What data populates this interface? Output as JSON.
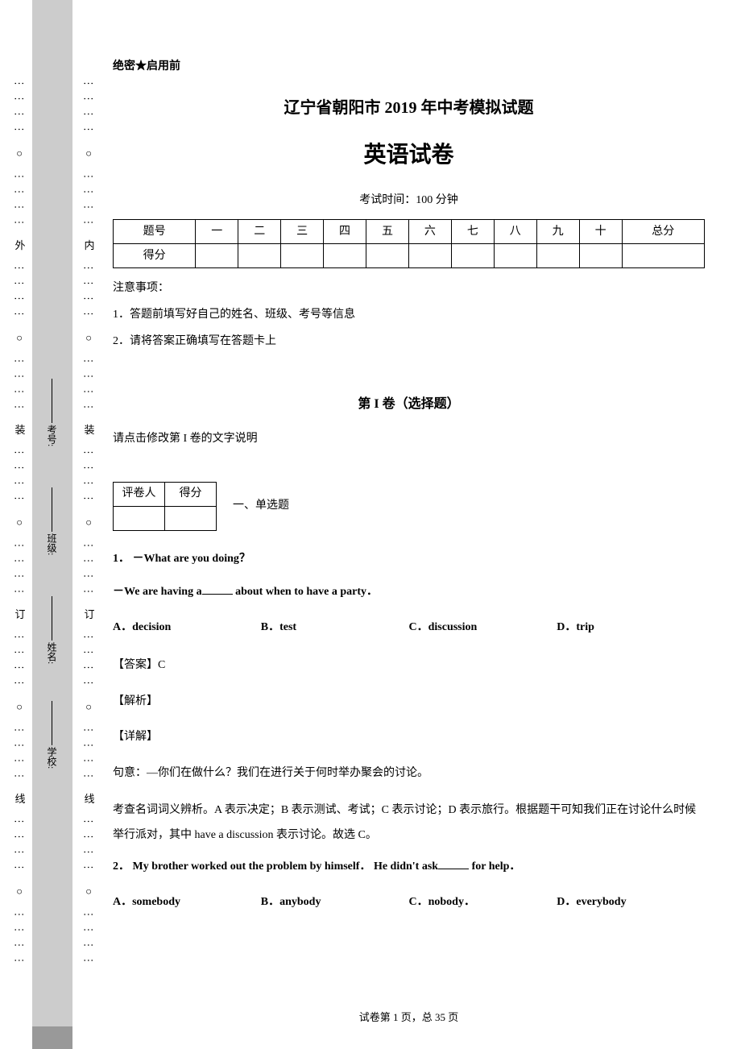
{
  "margin_outer": "⋮⋮⋮⋮ ○ ⋮⋮⋮⋮ 外 ⋮⋮⋮⋮ ○ ⋮⋮⋮⋮ 装 ⋮⋮⋮⋮ ○ ⋮⋮⋮⋮ 订 ⋮⋮⋮⋮ ○ ⋮⋮⋮⋮ 线 ⋮⋮⋮⋮ ○ ⋮⋮⋮⋮",
  "margin_inner": "⋮⋮⋮⋮ ○ ⋮⋮⋮⋮ 内 ⋮⋮⋮⋮ ○ ⋮⋮⋮⋮ 装 ⋮⋮⋮⋮ ○ ⋮⋮⋮⋮ 订 ⋮⋮⋮⋮ ○ ⋮⋮⋮⋮ 线 ⋮⋮⋮⋮ ○ ⋮⋮⋮⋮",
  "labels": {
    "school": "学校:",
    "name": "姓名:",
    "class": "班级:",
    "examno": "考号:"
  },
  "header": {
    "confidential": "绝密★启用前",
    "title_line1": "辽宁省朝阳市 2019 年中考模拟试题",
    "title_line2": "英语试卷",
    "exam_time": "考试时间：100 分钟"
  },
  "score_table": {
    "headers": [
      "题号",
      "一",
      "二",
      "三",
      "四",
      "五",
      "六",
      "七",
      "八",
      "九",
      "十",
      "总分"
    ],
    "row2_label": "得分"
  },
  "notice": {
    "title": "注意事项：",
    "items": [
      "1．答题前填写好自己的姓名、班级、考号等信息",
      "2．请将答案正确填写在答题卡上"
    ]
  },
  "section1": {
    "title": "第 I 卷（选择题）",
    "desc": "请点击修改第 I 卷的文字说明"
  },
  "grader_table": {
    "c1": "评卷人",
    "c2": "得分"
  },
  "part_label": "一、单选题",
  "q1": {
    "number_prefix": "1．",
    "line1": "－What are you doing？",
    "line2_prefix": "－We are having a",
    "line2_suffix": "   about when to have a party．",
    "options": {
      "a": "A．decision",
      "b": "B．test",
      "c": "C．discussion",
      "d": "D．trip"
    },
    "answer": "【答案】C",
    "explain": "【解析】",
    "detail": "【详解】",
    "meaning": "句意：—你们在做什么？我们在进行关于何时举办聚会的讨论。",
    "analysis": "考查名词词义辨析。A 表示决定；B 表示测试、考试；C 表示讨论；D 表示旅行。根据题干可知我们正在讨论什么时候举行派对，其中 have a discussion 表示讨论。故选 C。"
  },
  "q2": {
    "number_prefix": "2．",
    "line1_a": "My brother worked out the problem by himself． He didn't ask",
    "line1_b": "  for help．",
    "options": {
      "a": "A．somebody",
      "b": "B．anybody",
      "c": "C．nobody．",
      "d": "D．everybody"
    }
  },
  "footer": "试卷第 1 页，总 35 页"
}
